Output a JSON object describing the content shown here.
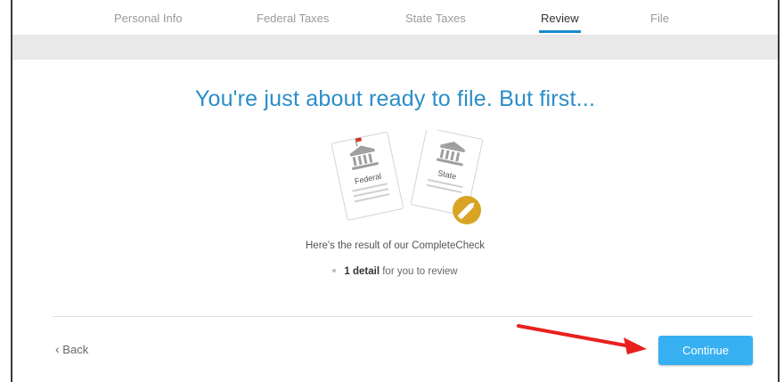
{
  "nav": {
    "steps": [
      {
        "label": "Personal Info"
      },
      {
        "label": "Federal Taxes"
      },
      {
        "label": "State Taxes"
      },
      {
        "label": "Review",
        "active": true
      },
      {
        "label": "File"
      }
    ]
  },
  "main": {
    "headline": "You're just about ready to file. But first...",
    "illustration": {
      "federal_label": "Federal",
      "state_label": "State",
      "icon": "edit-pencil-icon"
    },
    "result_text": "Here's the result of our CompleteCheck",
    "detail": {
      "count_text": "1 detail",
      "suffix_text": " for you to review"
    }
  },
  "footer": {
    "back_label": "Back",
    "continue_label": "Continue"
  },
  "annotation": {
    "arrow_color": "#e8211f"
  },
  "colors": {
    "accent": "#2a8ec8",
    "button": "#37b0f2",
    "pencil_badge": "#d7a424"
  }
}
